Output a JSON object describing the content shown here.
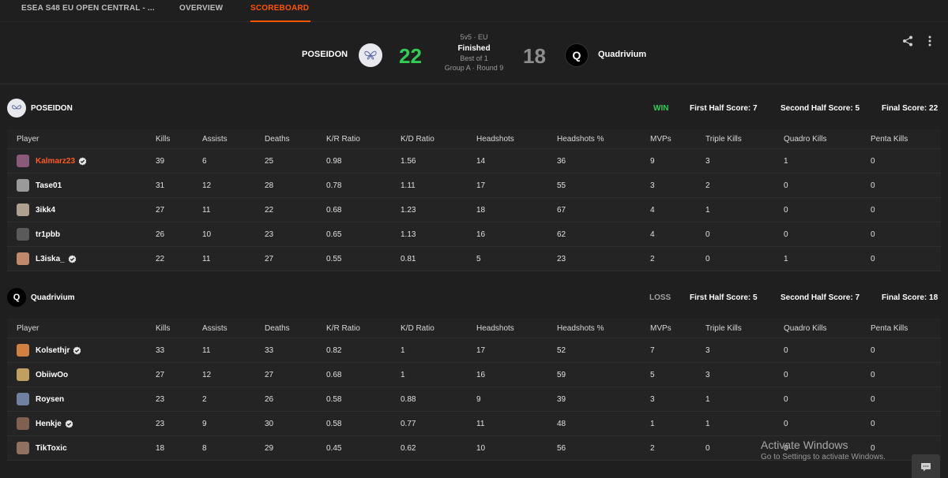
{
  "nav": {
    "tabs": [
      {
        "label": "ESEA S48 EU OPEN CENTRAL - ...",
        "active": false
      },
      {
        "label": "OVERVIEW",
        "active": false
      },
      {
        "label": "SCOREBOARD",
        "active": true
      }
    ]
  },
  "match": {
    "team1": {
      "name": "POSEIDON",
      "score": "22"
    },
    "team2": {
      "name": "Quadrivium",
      "score": "18"
    },
    "format": "5v5 · EU",
    "status": "Finished",
    "best_of": "Best of 1",
    "group_round": "Group A · Round 9"
  },
  "columns": [
    "Player",
    "Kills",
    "Assists",
    "Deaths",
    "K/R Ratio",
    "K/D Ratio",
    "Headshots",
    "Headshots %",
    "MVPs",
    "Triple Kills",
    "Quadro Kills",
    "Penta Kills"
  ],
  "teams": [
    {
      "name": "POSEIDON",
      "result": "WIN",
      "result_color": "#33cc55",
      "first_half": "First Half Score: 7",
      "second_half": "Second Half Score: 5",
      "final": "Final Score: 22",
      "players": [
        {
          "name": "Kalmarz23",
          "verified": true,
          "highlight": true,
          "avatar_color": "#8a5a7a",
          "stats": [
            "39",
            "6",
            "25",
            "0.98",
            "1.56",
            "14",
            "36",
            "9",
            "3",
            "1",
            "0"
          ]
        },
        {
          "name": "Tase01",
          "verified": false,
          "highlight": false,
          "avatar_color": "#9a9a9a",
          "stats": [
            "31",
            "12",
            "28",
            "0.78",
            "1.11",
            "17",
            "55",
            "3",
            "2",
            "0",
            "0"
          ]
        },
        {
          "name": "3ikk4",
          "verified": false,
          "highlight": false,
          "avatar_color": "#b0a090",
          "stats": [
            "27",
            "11",
            "22",
            "0.68",
            "1.23",
            "18",
            "67",
            "4",
            "1",
            "0",
            "0"
          ]
        },
        {
          "name": "tr1pbb",
          "verified": false,
          "highlight": false,
          "avatar_color": "#5a5a5a",
          "stats": [
            "26",
            "10",
            "23",
            "0.65",
            "1.13",
            "16",
            "62",
            "4",
            "0",
            "0",
            "0"
          ]
        },
        {
          "name": "L3iska_",
          "verified": true,
          "highlight": false,
          "avatar_color": "#c08a6a",
          "stats": [
            "22",
            "11",
            "27",
            "0.55",
            "0.81",
            "5",
            "23",
            "2",
            "0",
            "1",
            "0"
          ]
        }
      ]
    },
    {
      "name": "Quadrivium",
      "result": "LOSS",
      "result_color": "#a0a0a0",
      "first_half": "First Half Score: 5",
      "second_half": "Second Half Score: 7",
      "final": "Final Score: 18",
      "players": [
        {
          "name": "Kolsethjr",
          "verified": true,
          "highlight": false,
          "avatar_color": "#d08040",
          "stats": [
            "33",
            "11",
            "33",
            "0.82",
            "1",
            "17",
            "52",
            "7",
            "3",
            "0",
            "0"
          ]
        },
        {
          "name": "ObiiwOo",
          "verified": false,
          "highlight": false,
          "avatar_color": "#c0a060",
          "stats": [
            "27",
            "12",
            "27",
            "0.68",
            "1",
            "16",
            "59",
            "5",
            "3",
            "0",
            "0"
          ]
        },
        {
          "name": "Roysen",
          "verified": false,
          "highlight": false,
          "avatar_color": "#7080a0",
          "stats": [
            "23",
            "2",
            "26",
            "0.58",
            "0.88",
            "9",
            "39",
            "3",
            "1",
            "0",
            "0"
          ]
        },
        {
          "name": "Henkje",
          "verified": true,
          "highlight": false,
          "avatar_color": "#806050",
          "stats": [
            "23",
            "9",
            "30",
            "0.58",
            "0.77",
            "11",
            "48",
            "1",
            "1",
            "0",
            "0"
          ]
        },
        {
          "name": "TikToxic",
          "verified": false,
          "highlight": false,
          "avatar_color": "#907060",
          "stats": [
            "18",
            "8",
            "29",
            "0.45",
            "0.62",
            "10",
            "56",
            "2",
            "0",
            "0",
            "0"
          ]
        }
      ]
    }
  ],
  "icons": {
    "share": "share-icon",
    "more": "more-vertical-icon",
    "verified": "verified-badge-icon",
    "chat": "chat-icon"
  },
  "watermark": {
    "line1": "Activate Windows",
    "line2": "Go to Settings to activate Windows."
  }
}
